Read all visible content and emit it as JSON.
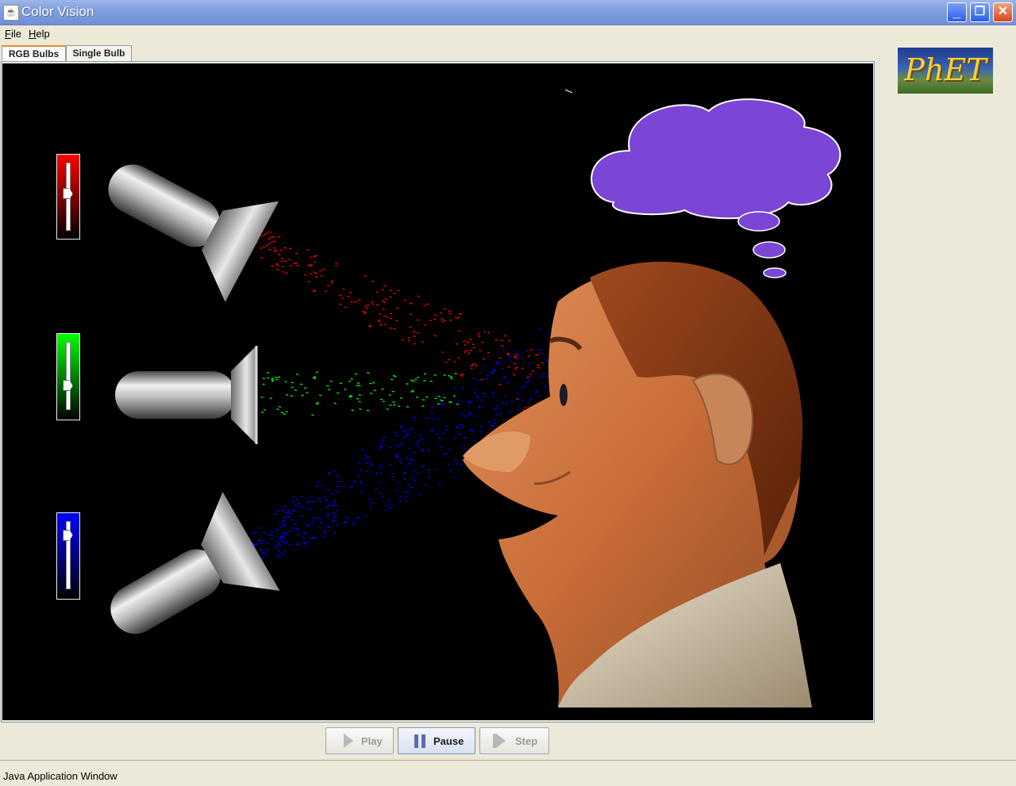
{
  "window": {
    "title": "Color Vision",
    "minimize": "_",
    "maximize": "❐",
    "close": "✕"
  },
  "menu": [
    {
      "label": "File"
    },
    {
      "label": "Help"
    }
  ],
  "tabs": [
    {
      "label": "RGB Bulbs",
      "active": true
    },
    {
      "label": "Single Bulb",
      "active": false
    }
  ],
  "logo": {
    "text": "PhET"
  },
  "bulbs": [
    {
      "color": "red",
      "hex": "#ff0000",
      "intensity_fraction": 0.55
    },
    {
      "color": "green",
      "hex": "#00ff00",
      "intensity_fraction": 0.33
    },
    {
      "color": "blue",
      "hex": "#0000ff",
      "intensity_fraction": 0.85
    }
  ],
  "thought_bubble_color": "#7b45d6",
  "controls": {
    "play": "Play",
    "pause": "Pause",
    "step": "Step",
    "active": "pause"
  },
  "status": {
    "text": "Java Application Window"
  }
}
